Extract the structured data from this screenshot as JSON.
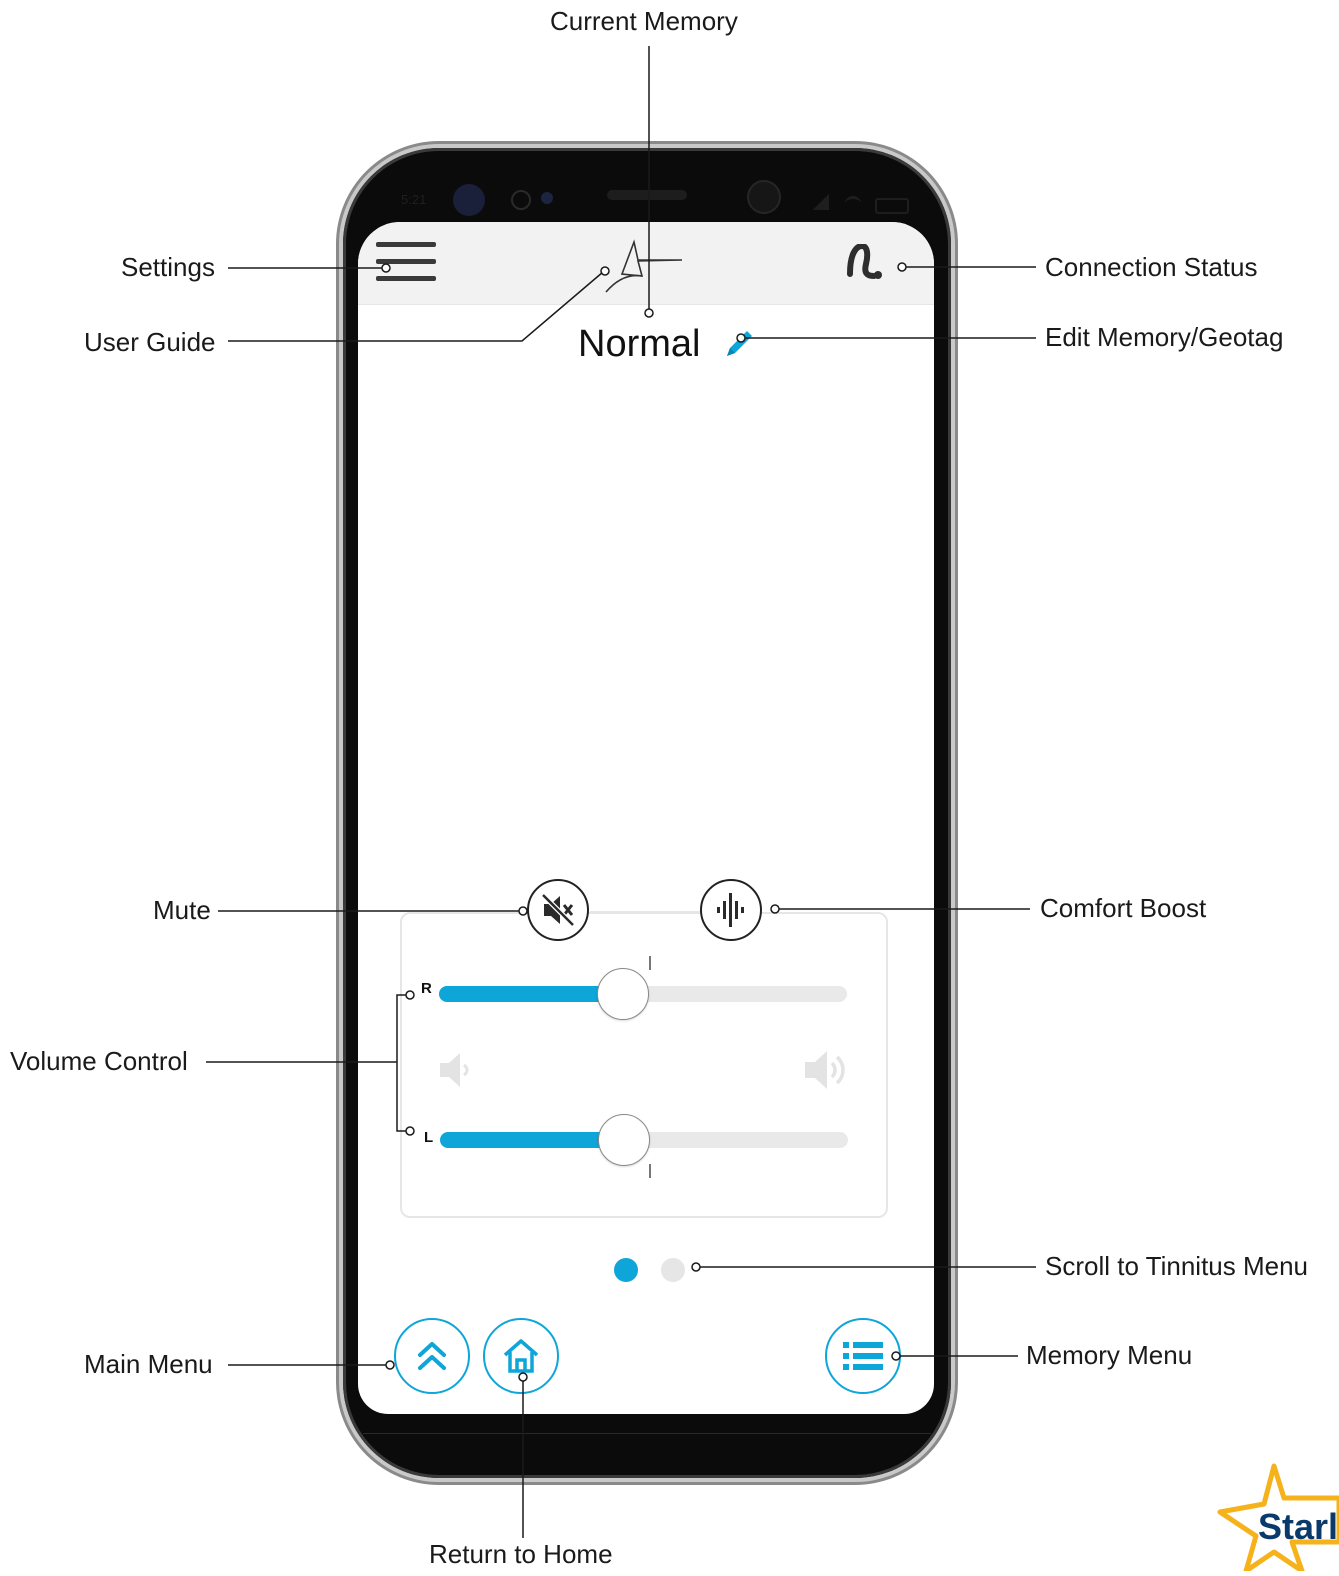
{
  "callouts": {
    "current_memory": "Current Memory",
    "settings": "Settings",
    "connection_status": "Connection Status",
    "user_guide": "User Guide",
    "edit_memory": "Edit Memory/Geotag",
    "mute": "Mute",
    "comfort_boost": "Comfort Boost",
    "volume_control": "Volume Control",
    "scroll_tinnitus": "Scroll to Tinnitus Menu",
    "main_menu": "Main Menu",
    "memory_menu": "Memory Menu",
    "return_home": "Return to Home"
  },
  "status_bar": {
    "time": "5:21"
  },
  "memory": {
    "name": "Normal"
  },
  "volume": {
    "right_label": "R",
    "left_label": "L",
    "right_level": 0.45,
    "left_level": 0.45
  },
  "pager": {
    "pages": 2,
    "active": 0
  },
  "brand": {
    "logo_text": "Starl"
  },
  "colors": {
    "accent": "#0ea5d8",
    "inactive_dot": "#e6e6e6",
    "navy": "#0a3a6b",
    "gold": "#f5b21b"
  },
  "icons": {
    "settings": "hamburger-icon",
    "user_guide": "shooting-star-icon",
    "connection": "hearing-aid-icon",
    "edit": "pencil-icon",
    "mute": "speaker-mute-icon",
    "comfort_boost": "sound-wave-icon",
    "vol_down": "speaker-low-icon",
    "vol_up": "speaker-high-icon",
    "main_menu": "double-chevron-up-icon",
    "home": "home-icon",
    "memory_menu": "list-icon"
  }
}
